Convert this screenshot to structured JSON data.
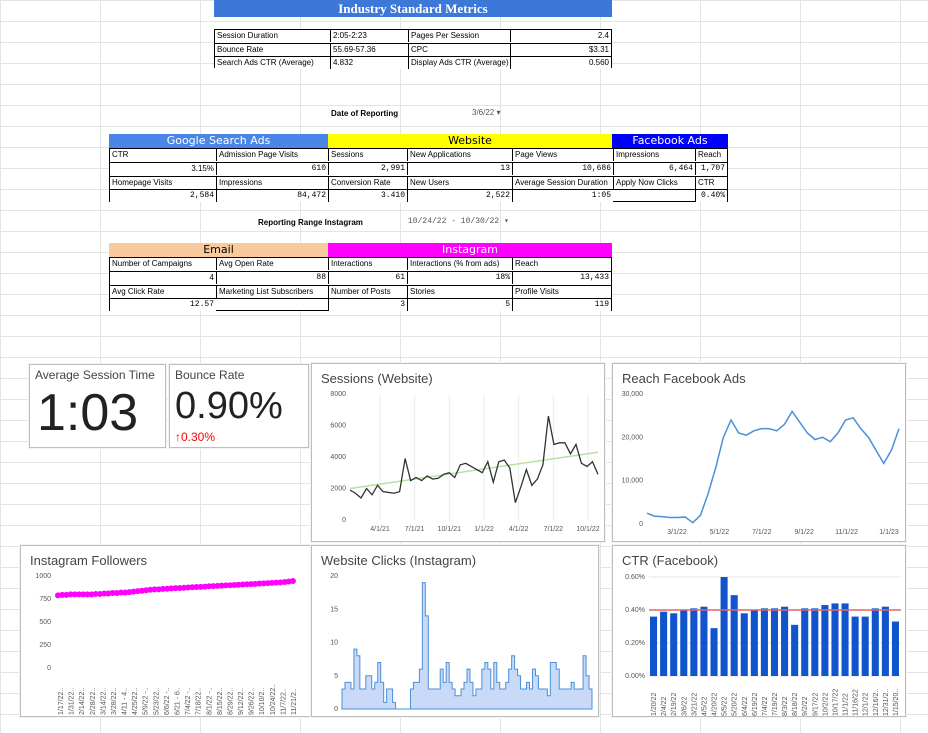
{
  "metrics": {
    "title": "Industry Standard Metrics",
    "rows": [
      [
        "Session Duration",
        "2:05-2:23",
        "Pages Per Session",
        "2.4"
      ],
      [
        "Bounce Rate",
        "55.69-57.36",
        "CPC",
        "$3.31"
      ],
      [
        "Search Ads CTR (Average)",
        "4.832",
        "Display Ads CTR (Average)",
        "0.560"
      ]
    ]
  },
  "reporting": {
    "date_label": "Date of Reporting",
    "date_value": "3/6/22",
    "range_label": "Reporting Range Instagram",
    "range_value": "10/24/22 - 10/30/22"
  },
  "google": {
    "title": "Google Search Ads",
    "ctr_label": "CTR",
    "ctr": "3.15%",
    "adm_label": "Admission Page Visits",
    "adm": "610",
    "home_label": "Homepage Visits",
    "home": "2,584",
    "imp_label": "Impressions",
    "imp": "84,472"
  },
  "website": {
    "title": "Website",
    "sess_label": "Sessions",
    "sess": "2,991",
    "newapp_label": "New Applications",
    "newapp": "13",
    "pv_label": "Page Views",
    "pv": "10,686",
    "conv_label": "Conversion Rate",
    "conv": "3.410",
    "nu_label": "New Users",
    "nu": "2,522",
    "asd_label": "Average Session Duration",
    "asd": "1:05"
  },
  "facebook": {
    "title": "Facebook Ads",
    "imp_label": "Impressions",
    "imp": "6,464",
    "reach_label": "Reach",
    "reach": "1,707",
    "apply_label": "Apply Now Clicks",
    "apply": "",
    "ctr_label": "CTR",
    "ctr": "0.40%"
  },
  "email": {
    "title": "Email",
    "camp_label": "Number of Campaigns",
    "camp": "4",
    "open_label": "Avg Open Rate",
    "open": "88",
    "click_label": "Avg Click Rate",
    "click": "12.57",
    "subs_label": "Marketing List Subscribers",
    "subs": ""
  },
  "instagram": {
    "title": "Instagram",
    "int_label": "Interactions",
    "int": "61",
    "intads_label": "Interactions (% from ads)",
    "intads": "18%",
    "reach_label": "Reach",
    "reach": "13,433",
    "posts_label": "Number of Posts",
    "posts": "3",
    "stories_label": "Stories",
    "stories": "5",
    "pvis_label": "Profile Visits",
    "pvis": "119"
  },
  "scorecards": {
    "avg_title": "Average Session Time",
    "avg_value": "1:03",
    "bounce_title": "Bounce Rate",
    "bounce_value": "0.90%",
    "bounce_delta": "0.30%"
  },
  "colors": {
    "google": "#4a86e8",
    "website": "#ffff00",
    "facebook": "#0000ff",
    "email": "#f9cb9c",
    "instagram": "#ff00ff",
    "line_blue": "#4a90d9",
    "bar_blue": "#1155cc",
    "trend_green": "#b7e1a1",
    "ref_red": "#e06666",
    "up_red": "#ff0000"
  },
  "chart_data": [
    {
      "type": "line",
      "title": "Sessions (Website)",
      "x_ticks": [
        "4/1/21",
        "7/1/21",
        "10/1/21",
        "1/1/22",
        "4/1/22",
        "7/1/22",
        "10/1/22"
      ],
      "y_ticks": [
        "0",
        "2000",
        "4000",
        "6000",
        "8000"
      ],
      "ylim": [
        0,
        8000
      ],
      "values": [
        1900,
        1700,
        1400,
        2000,
        1600,
        2200,
        1800,
        1750,
        1700,
        1800,
        3900,
        2500,
        2700,
        2500,
        2800,
        2600,
        2650,
        2900,
        3000,
        2700,
        3500,
        3600,
        3400,
        3200,
        3000,
        3700,
        2400,
        3700,
        3800,
        3300,
        1100,
        2100,
        3200,
        2200,
        2600,
        3500,
        6600,
        4800,
        4900,
        4900,
        4200,
        4800,
        3600,
        3400,
        3700,
        2900
      ],
      "trend": [
        2000,
        4300
      ]
    },
    {
      "type": "line",
      "title": "Reach Facebook Ads",
      "x_ticks": [
        "3/1/22",
        "5/1/22",
        "7/1/22",
        "9/1/22",
        "11/1/22",
        "1/1/23"
      ],
      "y_ticks": [
        "0",
        "10,000",
        "20,000",
        "30,000"
      ],
      "ylim": [
        0,
        30000
      ],
      "values": [
        2500,
        1800,
        1700,
        1500,
        1500,
        1600,
        300,
        2000,
        7000,
        13000,
        20000,
        24000,
        21000,
        20500,
        21500,
        22000,
        22000,
        21500,
        23000,
        26000,
        23500,
        21000,
        19500,
        20000,
        19000,
        21000,
        24000,
        24500,
        22000,
        20000,
        17000,
        14000,
        17000,
        22000
      ]
    },
    {
      "type": "line",
      "title": "Instagram Followers",
      "x_ticks": [
        "1/17/22..",
        "1/31/22..",
        "2/14/22..",
        "2/28/22..",
        "3/14/22..",
        "3/28/22..",
        "4/11 - 4..",
        "4/25/22..",
        "5/9/22 -..",
        "5/23/22..",
        "6/6/22 -..",
        "6/21 - 6..",
        "7/4/22 -..",
        "7/18/22..",
        "8/1/22 -..",
        "8/15/22..",
        "8/29/22..",
        "9/12/22..",
        "9/26/22..",
        "10/10/2..",
        "10/24/22..",
        "11/7/22..",
        "11/21/2.."
      ],
      "y_ticks": [
        "0",
        "250",
        "500",
        "750",
        "1000"
      ],
      "ylim": [
        0,
        1000
      ],
      "values": [
        790,
        795,
        795,
        800,
        800,
        800,
        800,
        800,
        800,
        805,
        805,
        810,
        810,
        815,
        815,
        820,
        820,
        825,
        830,
        835,
        840,
        845,
        850,
        855,
        855,
        860,
        862,
        865,
        868,
        870,
        872,
        875,
        878,
        880,
        882,
        885,
        888,
        890,
        892,
        895,
        898,
        900,
        902,
        905,
        908,
        910,
        912,
        915,
        918,
        920,
        922,
        925,
        928,
        930,
        935,
        940,
        945
      ]
    },
    {
      "type": "area",
      "title": "Website Clicks (Instagram)",
      "y_ticks": [
        "0",
        "5",
        "10",
        "15",
        "20"
      ],
      "ylim": [
        0,
        20
      ],
      "values": [
        3,
        4,
        4,
        3,
        9,
        8,
        3,
        3,
        5,
        5,
        3,
        4,
        7,
        4,
        1,
        3,
        3,
        1,
        0,
        0,
        0,
        0,
        0,
        3,
        4,
        4,
        6,
        19,
        14,
        3,
        3,
        3,
        3,
        6,
        4,
        7,
        4,
        3,
        2,
        2,
        3,
        4,
        6,
        4,
        2,
        3,
        3,
        6,
        7,
        6,
        3,
        7,
        4,
        3,
        3,
        4,
        6,
        8,
        6,
        5,
        3,
        3,
        4,
        3,
        6,
        5,
        3,
        3,
        3,
        2,
        7,
        7,
        6,
        3,
        3,
        3,
        3,
        4,
        3,
        3,
        3,
        8,
        5,
        3
      ]
    },
    {
      "type": "bar",
      "title": "CTR (Facebook)",
      "y_ticks": [
        "0.00%",
        "0.20%",
        "0.40%",
        "0.60%"
      ],
      "ylim": [
        0,
        0.006
      ],
      "reference": 0.004,
      "categories": [
        "1/20/22",
        "2/4/22",
        "2/19/22",
        "3/6/22",
        "3/21/22",
        "4/5/22",
        "4/20/22",
        "5/5/22",
        "5/20/22",
        "6/4/22",
        "6/19/22",
        "7/4/22",
        "7/19/22",
        "8/3/22",
        "8/18/22",
        "9/2/22",
        "9/17/22",
        "10/2/22",
        "10/17/22",
        "11/1/22",
        "11/16/22",
        "12/1/22",
        "12/16/2..",
        "12/31/2..",
        "1/15/20.."
      ],
      "values": [
        0.0036,
        0.0039,
        0.0038,
        0.004,
        0.0041,
        0.0042,
        0.0029,
        0.006,
        0.0049,
        0.0038,
        0.004,
        0.0041,
        0.0041,
        0.0042,
        0.0031,
        0.0041,
        0.0041,
        0.0043,
        0.0044,
        0.0044,
        0.0036,
        0.0036,
        0.0041,
        0.0042,
        0.0033
      ]
    }
  ]
}
